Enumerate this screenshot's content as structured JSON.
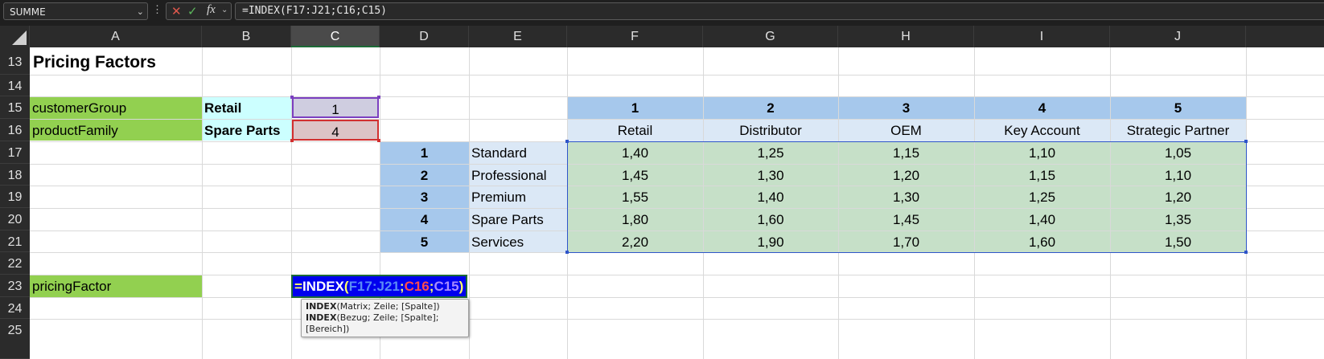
{
  "formula_bar": {
    "name_box": "SUMME",
    "name_box_icon": "chevron-down-icon",
    "separator": "⋮",
    "cancel_icon": "cancel-x-icon",
    "enter_icon": "enter-check-icon",
    "fx_label": "fx",
    "formula": "=INDEX(F17:J21;C16;C15)"
  },
  "columns": [
    "A",
    "B",
    "C",
    "D",
    "E",
    "F",
    "G",
    "H",
    "I",
    "J"
  ],
  "selected_column": "C",
  "rows": [
    "13",
    "14",
    "15",
    "16",
    "17",
    "18",
    "19",
    "20",
    "21",
    "22",
    "23",
    "24",
    "25"
  ],
  "cells": {
    "title": "Pricing Factors",
    "a15": "customerGroup",
    "b15": "Retail",
    "c15": "1",
    "a16": "productFamily",
    "b16": "Spare Parts",
    "c16": "4",
    "a23": "pricingFactor"
  },
  "matrix": {
    "col_indices": [
      "1",
      "2",
      "3",
      "4",
      "5"
    ],
    "col_labels": [
      "Retail",
      "Distributor",
      "OEM",
      "Key Account",
      "Strategic Partner"
    ],
    "row_indices": [
      "1",
      "2",
      "3",
      "4",
      "5"
    ],
    "row_labels": [
      "Standard",
      "Professional",
      "Premium",
      "Spare Parts",
      "Services"
    ],
    "values": [
      [
        "1,40",
        "1,25",
        "1,15",
        "1,10",
        "1,05"
      ],
      [
        "1,45",
        "1,30",
        "1,20",
        "1,15",
        "1,10"
      ],
      [
        "1,55",
        "1,40",
        "1,30",
        "1,25",
        "1,20"
      ],
      [
        "1,80",
        "1,60",
        "1,45",
        "1,40",
        "1,35"
      ],
      [
        "2,20",
        "1,90",
        "1,70",
        "1,60",
        "1,50"
      ]
    ]
  },
  "editing_formula": {
    "eq": "=",
    "fn": "INDEX",
    "open": "(",
    "ref1": "F17:J21",
    "sep1": ";",
    "ref2": "C16",
    "sep2": ";",
    "ref3": "C15",
    "close": ")"
  },
  "tooltip": {
    "line1_fn": "INDEX",
    "line1_args": "(Matrix; Zeile; [Spalte])",
    "line2_fn": "INDEX",
    "line2_args": "(Bezug; Zeile; [Spalte]; [Bereich])"
  },
  "colors": {
    "green_fill": "#92d050",
    "cyan_fill": "#ccffff",
    "header_blue": "#a6c8ec",
    "pale_blue": "#dbe8f6",
    "mint_fill": "#c6e0c8",
    "edit_cell_blue": "#0000ee"
  }
}
